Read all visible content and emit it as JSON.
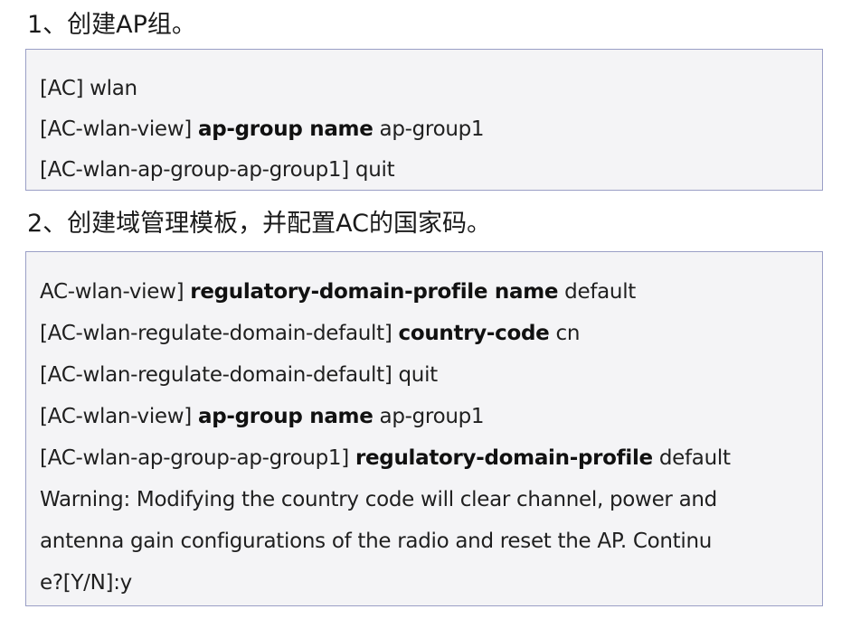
{
  "section1": {
    "heading": "1、创建AP组。",
    "lines": [
      [
        {
          "t": "[AC] wlan",
          "b": false
        }
      ],
      [
        {
          "t": "[AC-wlan-view] ",
          "b": false
        },
        {
          "t": "ap-group name",
          "b": true
        },
        {
          "t": " ap-group1",
          "b": false
        }
      ],
      [
        {
          "t": "[AC-wlan-ap-group-ap-group1] quit",
          "b": false
        }
      ]
    ]
  },
  "section2": {
    "heading": "2、创建域管理模板，并配置AC的国家码。",
    "lines": [
      [
        {
          "t": "AC-wlan-view] ",
          "b": false
        },
        {
          "t": "regulatory-domain-profile name",
          "b": true
        },
        {
          "t": " default",
          "b": false
        }
      ],
      [
        {
          "t": "[AC-wlan-regulate-domain-default] ",
          "b": false
        },
        {
          "t": "country-code",
          "b": true
        },
        {
          "t": " cn",
          "b": false
        }
      ],
      [
        {
          "t": "[AC-wlan-regulate-domain-default] quit",
          "b": false
        }
      ],
      [
        {
          "t": "[AC-wlan-view] ",
          "b": false
        },
        {
          "t": "ap-group name",
          "b": true
        },
        {
          "t": " ap-group1",
          "b": false
        }
      ],
      [
        {
          "t": "[AC-wlan-ap-group-ap-group1] ",
          "b": false
        },
        {
          "t": "regulatory-domain-profile",
          "b": true
        },
        {
          "t": " default",
          "b": false
        }
      ],
      [
        {
          "t": "Warning: Modifying the country code will clear channel, power and",
          "b": false
        }
      ],
      [
        {
          "t": "antenna gain configurations of the radio and reset the AP. Continu",
          "b": false
        }
      ],
      [
        {
          "t": "e?[Y/N]:y",
          "b": false
        }
      ]
    ]
  }
}
